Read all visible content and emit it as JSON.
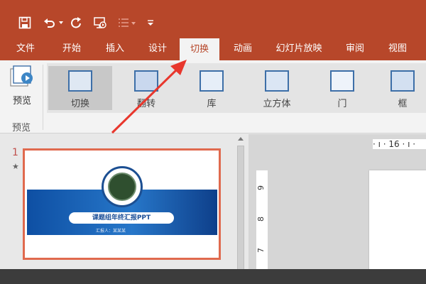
{
  "ribbon_tabs": [
    "文件",
    "开始",
    "插入",
    "设计",
    "切换",
    "动画",
    "幻灯片放映",
    "审阅",
    "视图"
  ],
  "active_tab": "切换",
  "preview": {
    "button_label": "预览",
    "group_label": "预览"
  },
  "transitions": [
    "切换",
    "翻转",
    "库",
    "立方体",
    "门",
    "框"
  ],
  "selected_transition": "切换",
  "slide_panel": {
    "slide_number": "1",
    "star": "★",
    "slide_title": "课题组年终汇报PPT",
    "slide_subtitle": "汇报人：某某某"
  },
  "ruler": {
    "horizontal": "· ı · 16 · ı ·",
    "vertical_marks": [
      "9",
      "8",
      "7"
    ]
  },
  "colors": {
    "accent": "#b7472a",
    "selection_outline": "#e06a4e",
    "slide_band": "#1659b0"
  },
  "icons": [
    "save-icon",
    "undo-icon",
    "redo-icon",
    "start-from-beginning-icon",
    "list-icon",
    "customize-qat-icon",
    "annotation-arrow"
  ]
}
